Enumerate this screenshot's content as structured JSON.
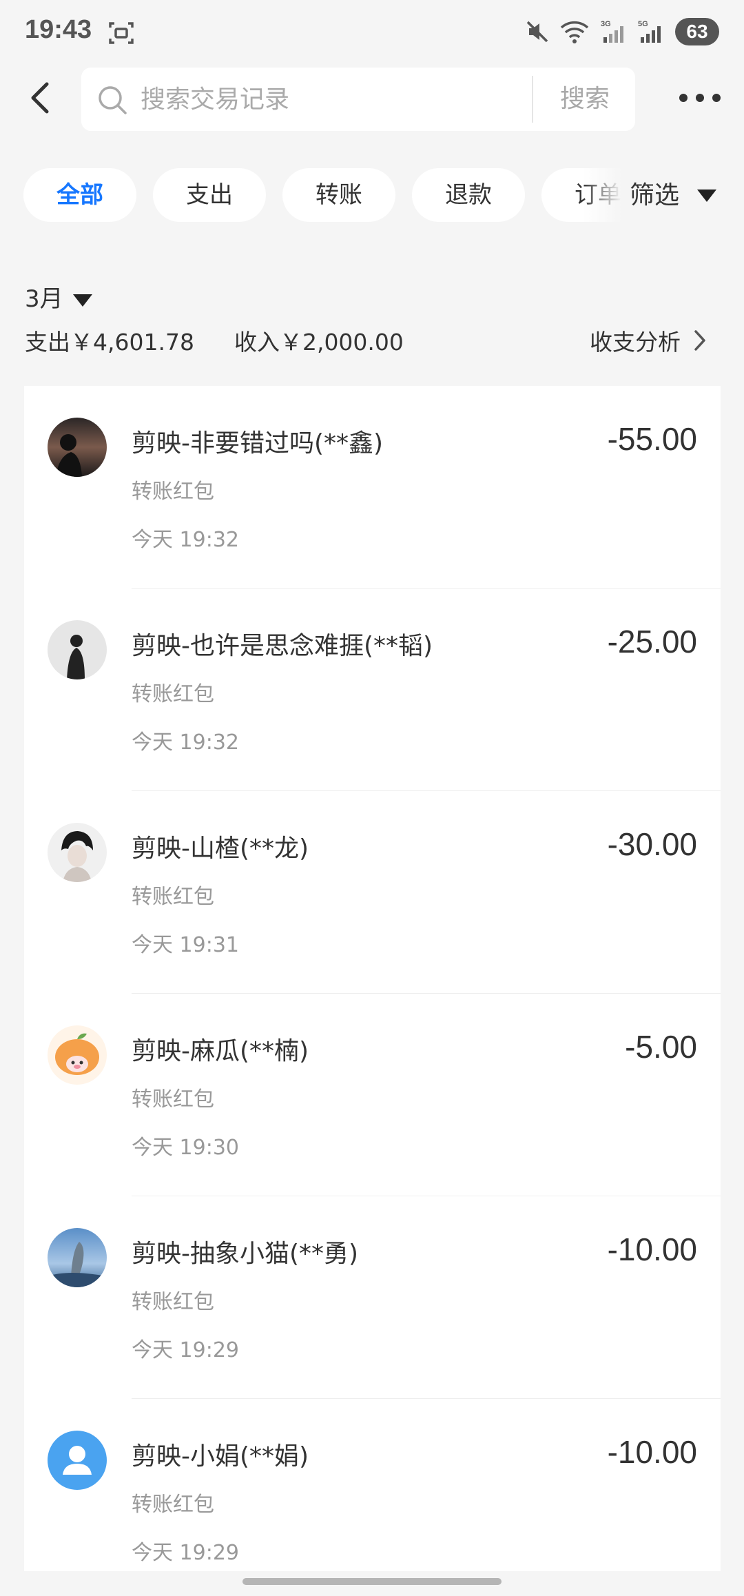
{
  "status_bar": {
    "time": "19:43",
    "battery": "63"
  },
  "search": {
    "placeholder": "搜索交易记录",
    "button": "搜索"
  },
  "filters": {
    "chips": [
      "全部",
      "支出",
      "转账",
      "退款",
      "订单"
    ],
    "filter_label": "筛选"
  },
  "summary": {
    "month": "3月",
    "expense": "支出￥4,601.78",
    "income": "收入￥2,000.00",
    "analysis": "收支分析"
  },
  "transactions": [
    {
      "title": "剪映-非要错过吗(**鑫)",
      "amount": "-55.00",
      "type": "转账红包",
      "time": "今天 19:32"
    },
    {
      "title": "剪映-也许是思念难捱(**韬)",
      "amount": "-25.00",
      "type": "转账红包",
      "time": "今天 19:32"
    },
    {
      "title": "剪映-山楂(**龙)",
      "amount": "-30.00",
      "type": "转账红包",
      "time": "今天 19:31"
    },
    {
      "title": "剪映-麻瓜(**楠)",
      "amount": "-5.00",
      "type": "转账红包",
      "time": "今天 19:30"
    },
    {
      "title": "剪映-抽象小猫(**勇)",
      "amount": "-10.00",
      "type": "转账红包",
      "time": "今天 19:29"
    },
    {
      "title": "剪映-小娟(**娟)",
      "amount": "-10.00",
      "type": "转账红包",
      "time": "今天 19:29"
    }
  ],
  "colors": {
    "accent": "#1677ff",
    "background": "#f5f5f5"
  }
}
